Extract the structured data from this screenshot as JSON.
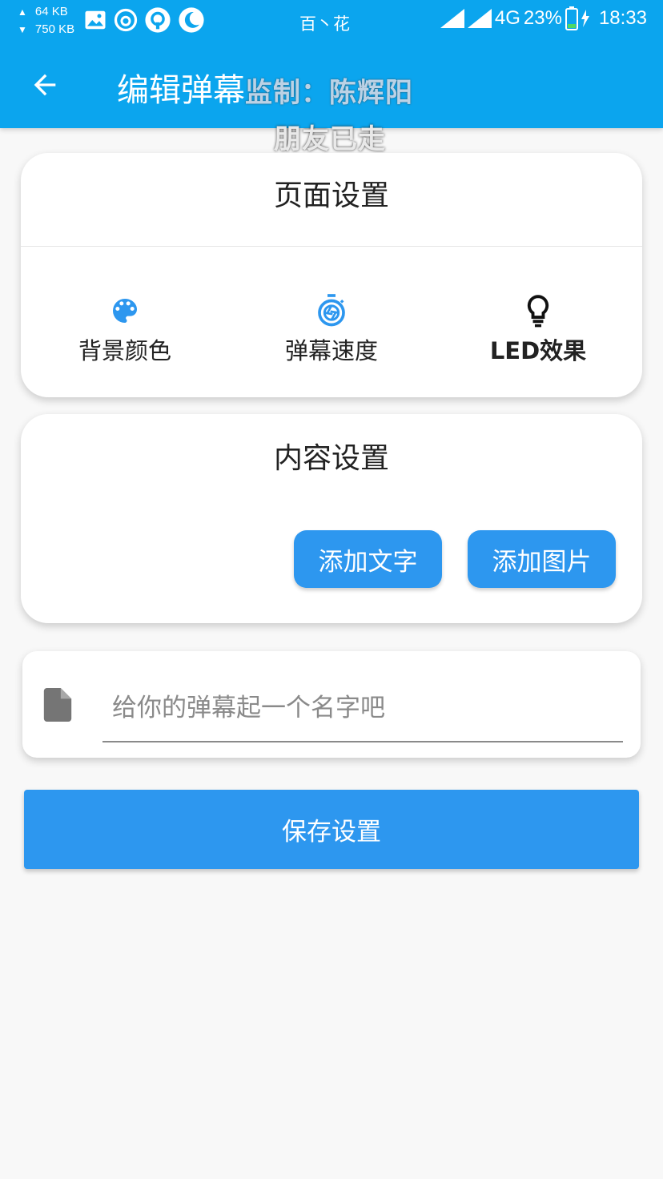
{
  "status_bar": {
    "upload_speed": "64 KB",
    "download_speed": "750 KB",
    "carrier": "百丶花",
    "network": "4G",
    "battery": "23%",
    "time": "18:33"
  },
  "app_bar": {
    "title": "编辑弹幕",
    "overlay_line1": "监制：陈辉阳",
    "overlay_line2": "朋友已走",
    "accent_color": "#0ba5ee"
  },
  "page_settings": {
    "title": "页面设置",
    "options": [
      {
        "label": "背景颜色",
        "icon": "palette-icon"
      },
      {
        "label": "弹幕速度",
        "icon": "shutter-timer-icon"
      },
      {
        "label": "LED效果",
        "icon": "lightbulb-icon"
      }
    ]
  },
  "content_settings": {
    "title": "内容设置",
    "add_text_label": "添加文字",
    "add_image_label": "添加图片"
  },
  "name_field": {
    "placeholder": "给你的弹幕起一个名字吧",
    "value": ""
  },
  "save_button": {
    "label": "保存设置",
    "color": "#2d97ef"
  }
}
